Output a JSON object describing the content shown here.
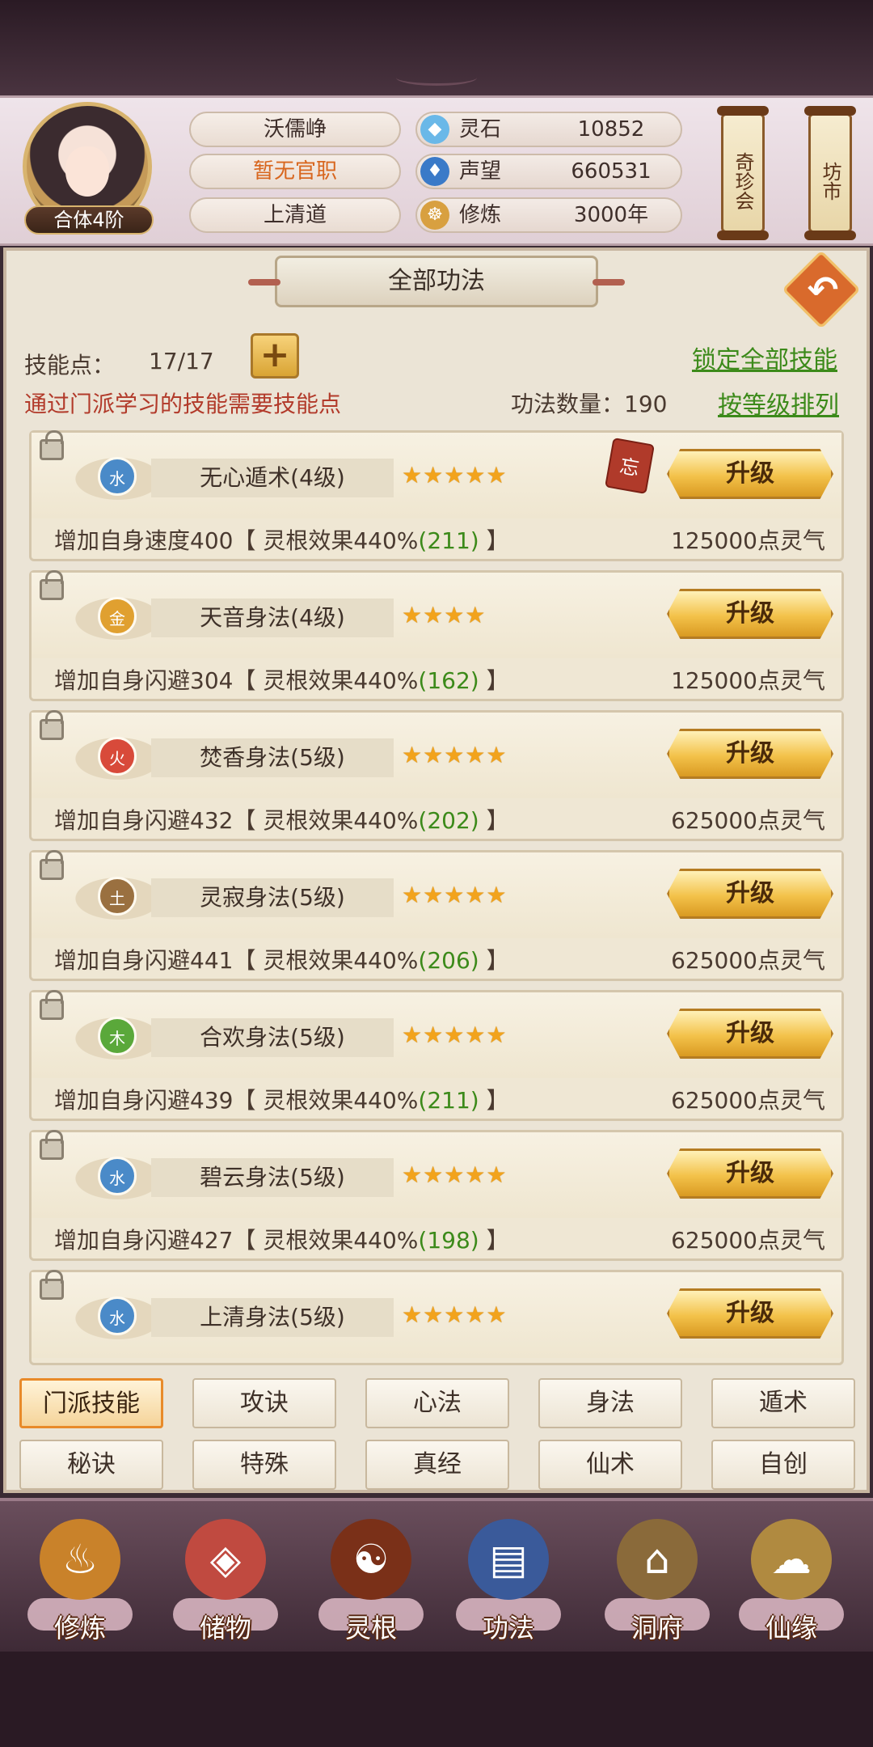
{
  "player": {
    "name": "沃儒峥",
    "title": "暂无官职",
    "sect": "上清道",
    "rank": "合体4阶"
  },
  "resources": [
    {
      "label": "灵石",
      "value": "10852",
      "icon": "spirit-stone-icon"
    },
    {
      "label": "声望",
      "value": "660531",
      "icon": "reputation-icon"
    },
    {
      "label": "修炼",
      "value": "3000年",
      "icon": "cultivation-icon"
    }
  ],
  "side_buttons": {
    "treasure": "奇珍会",
    "market": "坊市"
  },
  "panel": {
    "title": "全部功法",
    "skill_points_label": "技能点：",
    "skill_points_value": "17/17",
    "lock_all": "锁定全部技能",
    "hint": "通过门派学习的技能需要技能点",
    "count_label": "功法数量：190",
    "sort_link": "按等级排列"
  },
  "skills": [
    {
      "element": "水",
      "name": "无心遁术(4级)",
      "stars": "★★★★★",
      "upgrade": "升级",
      "forget": "忘",
      "desc_prefix": "增加自身速度400【 灵根效果440%",
      "desc_green": "(211)",
      "desc_suffix": " 】",
      "cost": "125000点灵气",
      "color": "#4a8ac8"
    },
    {
      "element": "金",
      "name": "天音身法(4级)",
      "stars": "★★★★",
      "upgrade": "升级",
      "forget": "",
      "desc_prefix": "增加自身闪避304【 灵根效果440%",
      "desc_green": "(162)",
      "desc_suffix": " 】",
      "cost": "125000点灵气",
      "color": "#e0a030"
    },
    {
      "element": "火",
      "name": "焚香身法(5级)",
      "stars": "★★★★★",
      "upgrade": "升级",
      "forget": "",
      "desc_prefix": "增加自身闪避432【 灵根效果440%",
      "desc_green": "(202)",
      "desc_suffix": " 】",
      "cost": "625000点灵气",
      "color": "#d84a3a"
    },
    {
      "element": "土",
      "name": "灵寂身法(5级)",
      "stars": "★★★★★",
      "upgrade": "升级",
      "forget": "",
      "desc_prefix": "增加自身闪避441【 灵根效果440%",
      "desc_green": "(206)",
      "desc_suffix": " 】",
      "cost": "625000点灵气",
      "color": "#9a7040"
    },
    {
      "element": "木",
      "name": "合欢身法(5级)",
      "stars": "★★★★★",
      "upgrade": "升级",
      "forget": "",
      "desc_prefix": "增加自身闪避439【 灵根效果440%",
      "desc_green": "(211)",
      "desc_suffix": " 】",
      "cost": "625000点灵气",
      "color": "#5aa83a"
    },
    {
      "element": "水",
      "name": "碧云身法(5级)",
      "stars": "★★★★★",
      "upgrade": "升级",
      "forget": "",
      "desc_prefix": "增加自身闪避427【 灵根效果440%",
      "desc_green": "(198)",
      "desc_suffix": " 】",
      "cost": "625000点灵气",
      "color": "#4a8ac8"
    },
    {
      "element": "水",
      "name": "上清身法(5级)",
      "stars": "★★★★★",
      "upgrade": "升级",
      "forget": "",
      "desc_prefix": "",
      "desc_green": "",
      "desc_suffix": "",
      "cost": "",
      "color": "#4a8ac8"
    }
  ],
  "tabs": [
    "门派技能",
    "攻诀",
    "心法",
    "身法",
    "遁术",
    "秘诀",
    "特殊",
    "真经",
    "仙术",
    "自创"
  ],
  "active_tab": "门派技能",
  "nav": [
    {
      "label": "修炼",
      "icon": "cultivate-icon",
      "glyph": "♨",
      "color": "#c9822a"
    },
    {
      "label": "储物",
      "icon": "storage-bag-icon",
      "glyph": "◈",
      "color": "#c04a40"
    },
    {
      "label": "灵根",
      "icon": "spirit-root-icon",
      "glyph": "☯",
      "color": "#7a3018"
    },
    {
      "label": "功法",
      "icon": "skill-book-icon",
      "glyph": "▤",
      "color": "#3a5a9a"
    },
    {
      "label": "洞府",
      "icon": "cave-dwelling-icon",
      "glyph": "⌂",
      "color": "#8a6a3a"
    },
    {
      "label": "仙缘",
      "icon": "immortal-fate-icon",
      "glyph": "☁",
      "color": "#b08a40"
    }
  ]
}
